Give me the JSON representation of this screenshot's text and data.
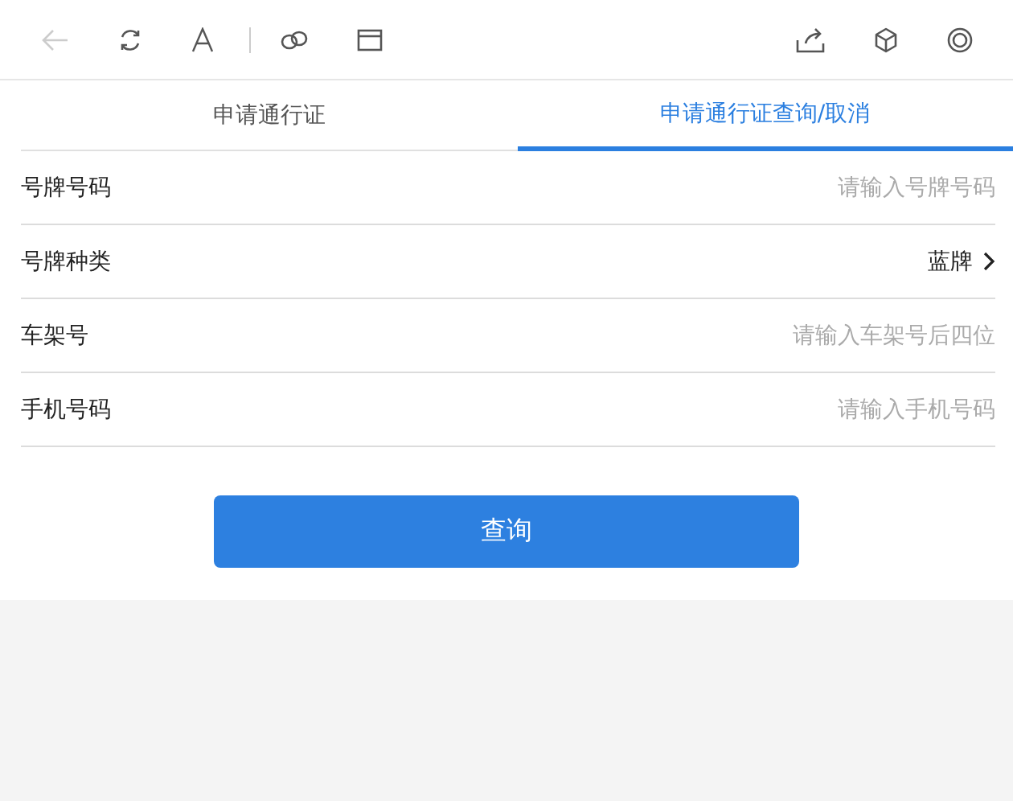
{
  "toolbar": {
    "back_disabled": true
  },
  "tabs": [
    {
      "label": "申请通行证",
      "selected": false
    },
    {
      "label": "申请通行证查询/取消",
      "selected": true
    }
  ],
  "fields": [
    {
      "kind": "input",
      "label": "号牌号码",
      "placeholder": "请输入号牌号码"
    },
    {
      "kind": "select",
      "label": "号牌种类",
      "value": "蓝牌"
    },
    {
      "kind": "input",
      "label": "车架号",
      "placeholder": "请输入车架号后四位"
    },
    {
      "kind": "input",
      "label": "手机号码",
      "placeholder": "请输入手机号码"
    }
  ],
  "submit": "查询"
}
